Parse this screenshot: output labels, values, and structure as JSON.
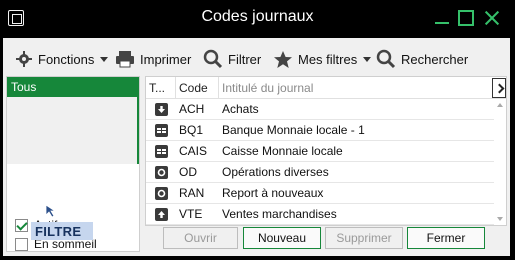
{
  "window": {
    "title": "Codes journaux"
  },
  "toolbar": {
    "fonctions": "Fonctions",
    "imprimer": "Imprimer",
    "filtrer": "Filtrer",
    "mes_filtres": "Mes filtres",
    "rechercher": "Rechercher"
  },
  "filter_panel": {
    "selected": "Tous",
    "actifs": {
      "label": "Actifs",
      "checked": true
    },
    "en_sommeil": {
      "label": "En sommeil",
      "checked": false
    },
    "tag": "FILTRE"
  },
  "grid": {
    "columns": [
      "T...",
      "Code",
      "Intitulé du journal"
    ],
    "rows": [
      {
        "type_icon": "download-icon",
        "code": "ACH",
        "title": "Achats"
      },
      {
        "type_icon": "bank-card-icon",
        "code": "BQ1",
        "title": "Banque Monnaie locale - 1"
      },
      {
        "type_icon": "bank-card-icon",
        "code": "CAIS",
        "title": "Caisse Monnaie locale"
      },
      {
        "type_icon": "circle-icon",
        "code": "OD",
        "title": "Opérations diverses"
      },
      {
        "type_icon": "circle-icon",
        "code": "RAN",
        "title": "Report à nouveaux"
      },
      {
        "type_icon": "upload-icon",
        "code": "VTE",
        "title": "Ventes marchandises"
      }
    ]
  },
  "buttons": {
    "ouvrir": "Ouvrir",
    "nouveau": "Nouveau",
    "supprimer": "Supprimer",
    "fermer": "Fermer"
  },
  "colors": {
    "accent": "#16873a",
    "window_controls": "#35c06a",
    "title_bar": "#000000"
  }
}
